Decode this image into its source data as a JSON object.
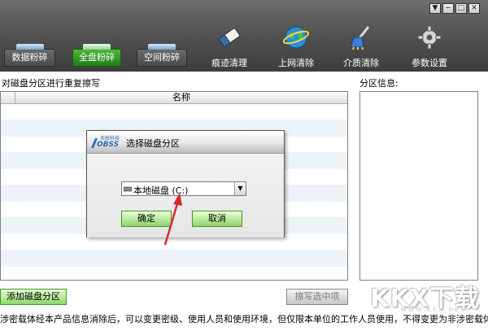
{
  "window_controls": [
    "▼",
    "−",
    "□",
    "✕"
  ],
  "tabs": [
    {
      "label": "数据粉碎"
    },
    {
      "label": "全盘粉碎"
    },
    {
      "label": "空间粉碎"
    }
  ],
  "tools": [
    {
      "label": "痕迹清理",
      "icon": "eraser-icon"
    },
    {
      "label": "上网清除",
      "icon": "globe-icon"
    },
    {
      "label": "介质清除",
      "icon": "broom-icon"
    },
    {
      "label": "参数设置",
      "icon": "gear-icon"
    }
  ],
  "main": {
    "heading": "对磁盘分区进行重复擦写",
    "table": {
      "columns": [
        "",
        "名称"
      ]
    },
    "right_title": "分区信息:",
    "add_button": "添加磁盘分区",
    "start_button": "擦写选中项"
  },
  "footer": "涉密载体经本产品信息消除后，可以变更密级、使用人员和使用环境，但仅限本单位的工作人员使用，不得变更为非涉密载体使用。",
  "watermark": {
    "main": "KKX下载",
    "sub": "www.kkx.net"
  },
  "dialog": {
    "logo_line1": "天桥科技",
    "logo_line2": "OBSS",
    "title": "选择磁盘分区",
    "select_value": "本地磁盘 (C:)",
    "ok": "确定",
    "cancel": "取消"
  },
  "colors": {
    "accent_green": "#3f9a2a",
    "toolbar": "#4a4a4a",
    "annotation": "#d42b2b"
  }
}
